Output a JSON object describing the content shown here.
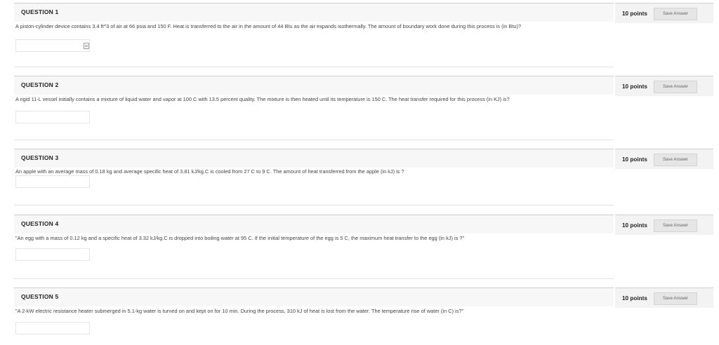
{
  "questions": [
    {
      "title": "QUESTION 1",
      "points": "10 points",
      "save_label": "Save Answer",
      "text": "A piston-cylinder device contains 3.4 ft^3 of air at 66 psia and 150 F. Heat is transferred to the air in the amount of 44 Btu as the air expands isothermally. The amount of boundary work done during this process is (in Btu)?",
      "answer_value": ""
    },
    {
      "title": "QUESTION 2",
      "points": "10 points",
      "save_label": "Save Answer",
      "text": "A rigid 11-L vessel initially contains a mixture of liquid water and vapor at 100 C with 13.5 percent quality. The mixture is then heated until its temperature is 150 C. The heat transfer required for this process (in KJ) is?",
      "answer_value": ""
    },
    {
      "title": "QUESTION 3",
      "points": "10 points",
      "save_label": "Save Answer",
      "text": "An apple with an average mass of 0.18 kg and average specific heat of 3.81 kJ/kg.C is cooled from 27 C to 9 C. The amount of heat transferred from the apple (in kJ) is ?",
      "answer_value": ""
    },
    {
      "title": "QUESTION 4",
      "points": "10 points",
      "save_label": "Save Answer",
      "text": "\"An egg with a mass of 0.12 kg and a specific heat of 3.32 kJ/kg.C is dropped into boiling water at 95 C. If the initial temperature of the egg is 5 C, the maximum heat transfer to the egg (in kJ) is ?\"",
      "answer_value": ""
    },
    {
      "title": "QUESTION 5",
      "points": "10 points",
      "save_label": "Save Answer",
      "text": "\"A 2-kW electric resistance heater submerged in 5.1-kg water is turned on and kept on for 10 min. During the process, 310 kJ of heat is lost from the water. The temperature rise of water (in C) is?\"",
      "answer_value": ""
    }
  ]
}
